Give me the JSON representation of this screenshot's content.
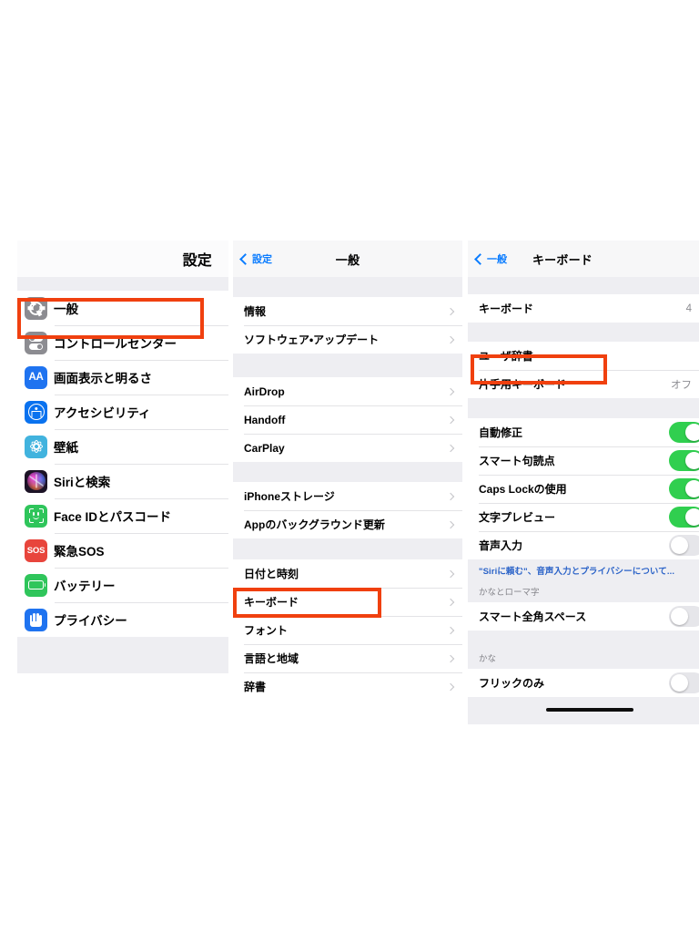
{
  "panels": {
    "settings": {
      "nav": {
        "title": "設定"
      },
      "items": [
        {
          "label": "一般",
          "icon": "gear-icon",
          "highlighted": true
        },
        {
          "label": "コントロールセンター",
          "icon": "control-center-icon",
          "highlighted": false
        },
        {
          "label": "画面表示と明るさ",
          "icon": "display-brightness-icon",
          "highlighted": false
        },
        {
          "label": "アクセシビリティ",
          "icon": "accessibility-icon",
          "highlighted": false
        },
        {
          "label": "壁紙",
          "icon": "wallpaper-icon",
          "highlighted": false
        },
        {
          "label": "Siriと検索",
          "icon": "siri-icon",
          "highlighted": false
        },
        {
          "label": "Face IDとパスコード",
          "icon": "face-id-icon",
          "highlighted": false
        },
        {
          "label": "緊急SOS",
          "icon": "emergency-sos-icon",
          "highlighted": false
        },
        {
          "label": "バッテリー",
          "icon": "battery-icon",
          "highlighted": false
        },
        {
          "label": "プライバシー",
          "icon": "privacy-hand-icon",
          "highlighted": false
        }
      ],
      "icon_glyphs": {
        "display": "AA",
        "sos": "SOS"
      }
    },
    "general": {
      "nav": {
        "back_label": "設定",
        "title": "一般"
      },
      "groups": [
        {
          "rows": [
            {
              "label": "情報",
              "value": ""
            },
            {
              "label": "ソフトウェア・アップデート",
              "value": ""
            }
          ]
        },
        {
          "rows": [
            {
              "label": "AirDrop",
              "value": ""
            },
            {
              "label": "Handoff",
              "value": ""
            },
            {
              "label": "CarPlay",
              "value": ""
            }
          ]
        },
        {
          "rows": [
            {
              "label": "iPhoneストレージ",
              "value": ""
            },
            {
              "label": "Appのバックグラウンド更新",
              "value": ""
            }
          ]
        },
        {
          "rows": [
            {
              "label": "日付と時刻",
              "value": ""
            },
            {
              "label": "キーボード",
              "value": "",
              "highlighted": true
            },
            {
              "label": "フォント",
              "value": ""
            },
            {
              "label": "言語と地域",
              "value": ""
            },
            {
              "label": "辞書",
              "value": ""
            }
          ]
        }
      ]
    },
    "keyboard": {
      "nav": {
        "back_label": "一般",
        "title": "キーボード"
      },
      "group1": [
        {
          "label": "キーボード",
          "value": "4"
        }
      ],
      "group2": [
        {
          "label": "ユーザ辞書",
          "value": "",
          "highlighted": true
        },
        {
          "label": "片手用キーボード",
          "value": "オフ"
        }
      ],
      "group3": [
        {
          "label": "自動修正",
          "toggle": "on"
        },
        {
          "label": "スマート句読点",
          "toggle": "on"
        },
        {
          "label": "Caps Lockの使用",
          "toggle": "on"
        },
        {
          "label": "文字プレビュー",
          "toggle": "on"
        },
        {
          "label": "音声入力",
          "toggle": "off"
        }
      ],
      "siri_note": "\"Siriに頼む\"、音声入力とプライバシーについて...",
      "section_kana_romaji": "かなとローマ字",
      "group4": [
        {
          "label": "スマート全角スペース",
          "toggle": "off"
        }
      ],
      "section_kana": "かな",
      "group5": [
        {
          "label": "フリックのみ",
          "toggle": "off"
        }
      ]
    }
  },
  "annotations": {
    "color": "#f0400f",
    "boxes": [
      {
        "target": "一般"
      },
      {
        "target": "キーボード"
      },
      {
        "target": "ユーザ辞書"
      }
    ]
  }
}
